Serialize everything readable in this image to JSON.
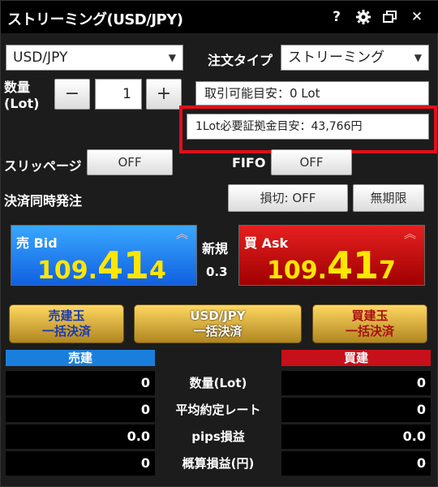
{
  "window": {
    "title": "ストリーミング(USD/JPY)",
    "icons": [
      "help-icon",
      "gear-icon",
      "restore-icon",
      "close-icon"
    ],
    "help_glyph": "?",
    "close_glyph": "✕"
  },
  "controls": {
    "symbol_value": "USD/JPY",
    "order_type_label": "注文タイプ",
    "order_type_value": "ストリーミング",
    "qty_label_line1": "数量",
    "qty_label_line2": "(Lot)",
    "qty_minus": "−",
    "qty_value": "1",
    "qty_plus": "+",
    "tradable_text": "取引可能目安：0 Lot",
    "margin_text": "1Lot必要証拠金目安：43,766円",
    "slippage_label": "スリッページ",
    "slippage_value": "OFF",
    "fifo_label": "FIFO",
    "fifo_value": "OFF",
    "simultaneous_label": "決済同時発注",
    "stoploss_value": "損切: OFF",
    "expiry_value": "無期限"
  },
  "prices": {
    "bid_label": "売 Bid",
    "bid_main": "109.",
    "bid_big": "41",
    "bid_small": "4",
    "ask_label": "買 Ask",
    "ask_main": "109.",
    "ask_big": "41",
    "ask_small": "7",
    "new_label": "新規",
    "spread": "0.3",
    "up_arrow": "︽"
  },
  "bulk": {
    "sell_line1": "売建玉",
    "sell_line2": "一括決済",
    "pair_line1": "USD/JPY",
    "pair_line2": "一括決済",
    "buy_line1": "買建玉",
    "buy_line2": "一括決済"
  },
  "table": {
    "sell_header": "売建",
    "buy_header": "買建",
    "rows": [
      {
        "sell": "0",
        "label": "数量(Lot)",
        "buy": "0"
      },
      {
        "sell": "0",
        "label": "平均約定レート",
        "buy": "0"
      },
      {
        "sell": "0.0",
        "label": "pips損益",
        "buy": "0.0"
      },
      {
        "sell": "0",
        "label": "概算損益(円)",
        "buy": "0"
      }
    ]
  },
  "colors": {
    "bid": "#1e7cf0",
    "ask": "#d01010",
    "price_digits": "#ffe600",
    "highlight": "#e0101b",
    "gold": "#d4a93a"
  }
}
